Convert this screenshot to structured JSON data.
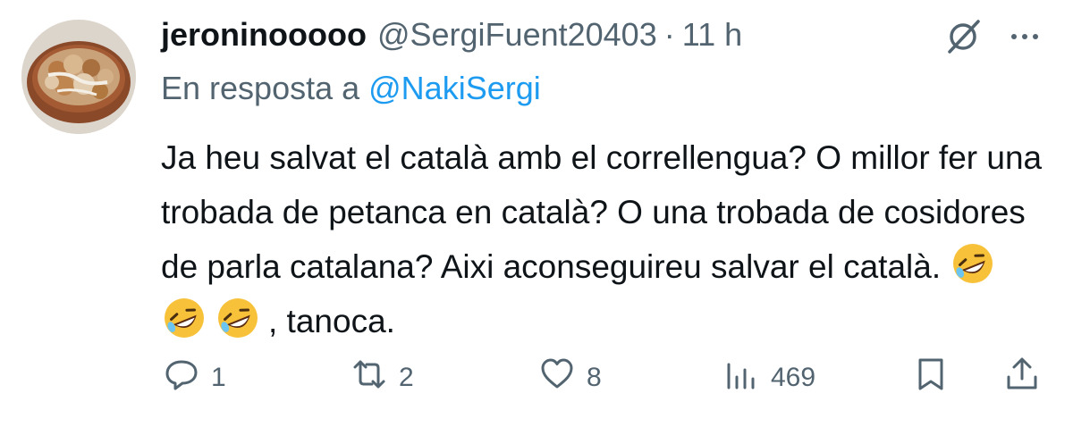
{
  "tweet": {
    "display_name": "jeroninooooo",
    "handle": "@SergiFuent20403",
    "separator": "·",
    "time": "11 h",
    "reply_prefix": "En resposta a",
    "reply_mention": "@NakiSergi",
    "text_main": "Ja heu salvat el català amb el correllengua? O millor fer una trobada de petanca en català? O una trobada de cosidores de parla catalana? Aixi aconseguireu salvar el català.",
    "emojis": [
      "rolling-on-floor-laughing",
      "rolling-on-floor-laughing",
      "rolling-on-floor-laughing"
    ],
    "text_tail": ", tanoca."
  },
  "actions": {
    "replies": "1",
    "reposts": "2",
    "likes": "8",
    "views": "469"
  },
  "icons": {
    "grok": "grok-icon",
    "more": "more-dots-icon",
    "reply": "reply-icon",
    "repost": "repost-icon",
    "like": "heart-icon",
    "views": "views-icon",
    "bookmark": "bookmark-icon",
    "share": "share-icon"
  },
  "colors": {
    "text": "#0f1419",
    "secondary": "#536471",
    "link": "#1d9bf0"
  }
}
